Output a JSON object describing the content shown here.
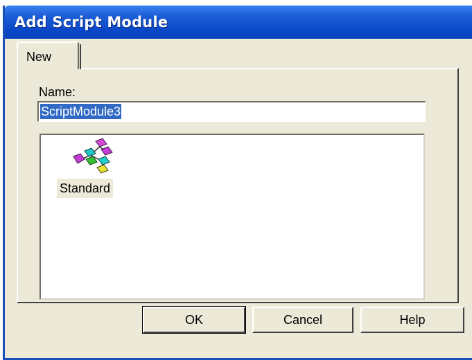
{
  "window": {
    "title": "Add Script Module"
  },
  "tabs": [
    {
      "label": "New",
      "selected": true
    }
  ],
  "form": {
    "name_label": "Name:",
    "name_value": "ScriptModule3"
  },
  "template_list": {
    "items": [
      {
        "label": "Standard",
        "icon": "script-module-icon",
        "selected": true
      }
    ]
  },
  "buttons": {
    "ok": "OK",
    "cancel": "Cancel",
    "help": "Help"
  },
  "colors": {
    "titlebar": "#0a47c8",
    "dialog_bg": "#ece9d8",
    "selection": "#316ac5"
  }
}
